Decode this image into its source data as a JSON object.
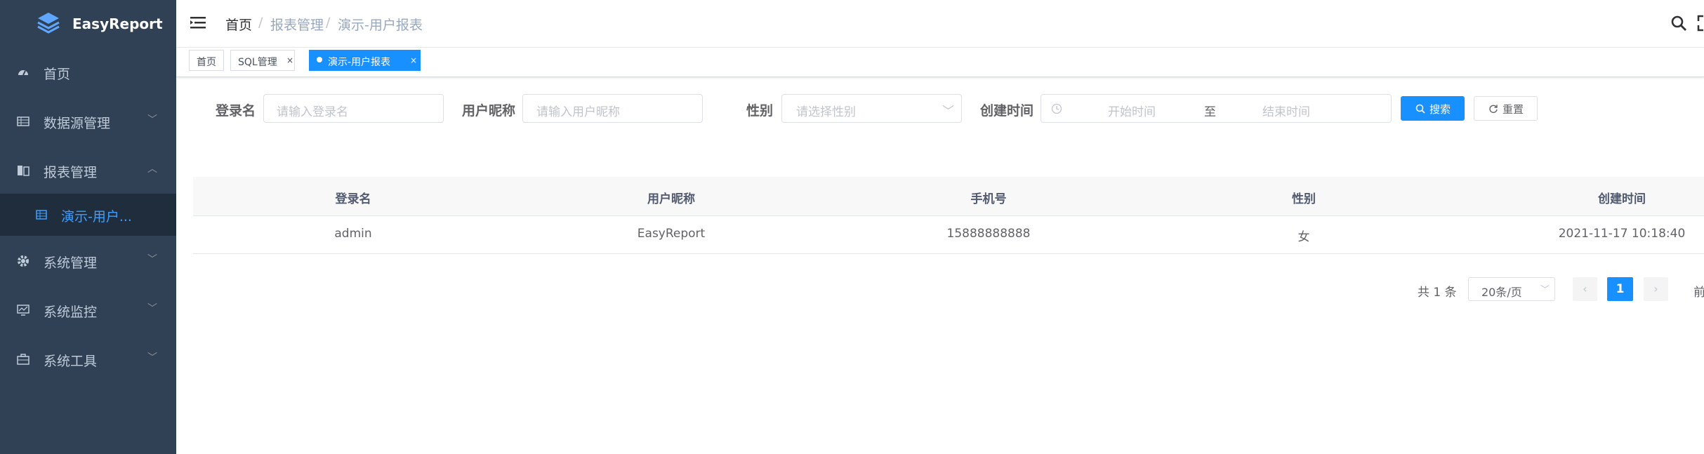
{
  "app": {
    "logo_text": "EasyReport"
  },
  "sidebar": {
    "items": [
      {
        "label": "首页",
        "icon": "dashboard-icon"
      },
      {
        "label": "数据源管理",
        "icon": "table-icon"
      },
      {
        "label": "报表管理",
        "icon": "report-icon"
      },
      {
        "label": "演示-用户...",
        "icon": "table-icon"
      },
      {
        "label": "系统管理",
        "icon": "gear-icon"
      },
      {
        "label": "系统监控",
        "icon": "monitor-icon"
      },
      {
        "label": "系统工具",
        "icon": "toolbox-icon"
      }
    ]
  },
  "breadcrumb": {
    "home": "首页",
    "sep": "/",
    "level2": "报表管理",
    "current": "演示-用户报表"
  },
  "tags": {
    "home": "首页",
    "sql": "SQL管理",
    "active": "演示-用户报表",
    "close": "×"
  },
  "search_form": {
    "login_name_label": "登录名",
    "login_name_placeholder": "请输入登录名",
    "nickname_label": "用户昵称",
    "nickname_placeholder": "请输入用户昵称",
    "gender_label": "性别",
    "gender_placeholder": "请选择性别",
    "created_label": "创建时间",
    "start_placeholder": "开始时间",
    "range_sep": "至",
    "end_placeholder": "结束时间",
    "search_button": "搜索",
    "reset_button": "重置"
  },
  "table": {
    "columns": [
      "登录名",
      "用户昵称",
      "手机号",
      "性别",
      "创建时间"
    ],
    "rows": [
      [
        "admin",
        "EasyReport",
        "15888888888",
        "女",
        "2021-11-17 10:18:40"
      ]
    ]
  },
  "pagination": {
    "total": "共 1 条",
    "page_size": "20条/页",
    "current": "1",
    "jump_prefix": "前"
  },
  "colors": {
    "sidebar_bg": "#304156",
    "primary": "#1890ff",
    "active_sub_bg": "#1f2d3d"
  }
}
